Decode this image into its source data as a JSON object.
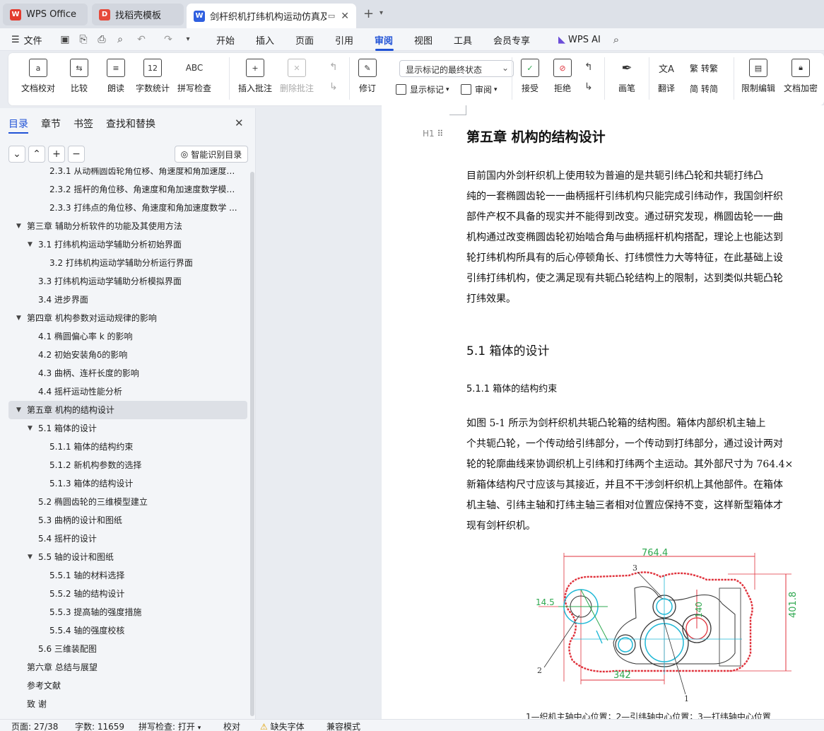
{
  "tabs": [
    {
      "label": "WPS Office",
      "icon": "wps-logo",
      "color": "#e33b2e"
    },
    {
      "label": "找稻壳模板",
      "icon": "docer-logo",
      "color": "#e64a3b"
    },
    {
      "label": "剑杆织机打纬机构运动仿真及",
      "icon": "word-doc-icon",
      "color": "#2f5fe0"
    }
  ],
  "menu": {
    "file": "文件",
    "items": [
      "开始",
      "插入",
      "页面",
      "引用",
      "审阅",
      "视图",
      "工具",
      "会员专享"
    ],
    "active": "审阅",
    "ai": "WPS AI"
  },
  "ribbon": {
    "doc_check": "文档校对",
    "compare": "比较",
    "read_aloud": "朗读",
    "word_count": "字数统计",
    "spell_check": "拼写检查",
    "insert_comment": "插入批注",
    "delete_comment": "删除批注",
    "revise": "修订",
    "markup_state": "显示标记的最终状态",
    "show_markup": "显示标记",
    "review": "审阅",
    "accept": "接受",
    "reject": "拒绝",
    "pen": "画笔",
    "translate": "翻译",
    "to_traditional": "转繁",
    "to_simplified": "转简",
    "restrict_edit": "限制编辑",
    "encrypt": "文档加密"
  },
  "nav": {
    "tabs": [
      "目录",
      "章节",
      "书签",
      "查找和替换"
    ],
    "smart_button": "智能识别目录",
    "toc": [
      {
        "text": "2.3.1 从动椭圆齿轮角位移、角速度和角加速度数学模型",
        "level": 3
      },
      {
        "text": "2.3.2 摇杆的角位移、角速度和角加速度数学模型 ...",
        "level": 3
      },
      {
        "text": "2.3.3  打纬点的角位移、角速度和角加速度数学 ...",
        "level": 3
      },
      {
        "text": "第三章  辅助分析软件的功能及其使用方法",
        "level": 1,
        "arrow": true
      },
      {
        "text": "3.1  打纬机构运动学辅助分析初始界面",
        "level": 2,
        "arrow": true
      },
      {
        "text": "3.2 打纬机构运动学辅助分析运行界面",
        "level": 3
      },
      {
        "text": "3.3  打纬机构运动学辅助分析模拟界面",
        "level": 2
      },
      {
        "text": "3.4 进步界面",
        "level": 2
      },
      {
        "text": "第四章  机构参数对运动规律的影响",
        "level": 1,
        "arrow": true
      },
      {
        "text": "4.1  椭圆偏心率 k 的影响",
        "level": 2
      },
      {
        "text": "4.2 初始安装角δ的影响",
        "level": 2
      },
      {
        "text": "4.3  曲柄、连杆长度的影响",
        "level": 2
      },
      {
        "text": "4.4  摇杆运动性能分析",
        "level": 2
      },
      {
        "text": "第五章  机构的结构设计",
        "level": 1,
        "arrow": true,
        "active": true
      },
      {
        "text": "5.1  箱体的设计",
        "level": 2,
        "arrow": true
      },
      {
        "text": "5.1.1  箱体的结构约束",
        "level": 3
      },
      {
        "text": "5.1.2  新机构参数的选择",
        "level": 3
      },
      {
        "text": "5.1.3  箱体的结构设计",
        "level": 3
      },
      {
        "text": "5.2  椭圆齿轮的三维模型建立",
        "level": 2
      },
      {
        "text": "5.3  曲柄的设计和图纸",
        "level": 2
      },
      {
        "text": "5.4  摇杆的设计",
        "level": 2
      },
      {
        "text": "5.5 轴的设计和图纸",
        "level": 2,
        "arrow": true
      },
      {
        "text": "5.5.1  轴的材料选择",
        "level": 3
      },
      {
        "text": "5.5.2  轴的结构设计",
        "level": 3
      },
      {
        "text": "5.5.3 提高轴的强度措施",
        "level": 3
      },
      {
        "text": "5.5.4  轴的强度校核",
        "level": 3
      },
      {
        "text": "5.6  三维装配图",
        "level": 2
      },
      {
        "text": "第六章  总结与展望",
        "level": 1
      },
      {
        "text": "参考文献",
        "level": 1
      },
      {
        "text": "致    谢",
        "level": 1
      }
    ]
  },
  "doc": {
    "h_marker": "H1",
    "chapter_title": "第五章  机构的结构设计",
    "para1": [
      "    目前国内外剑杆织机上使用较为普遍的是共轭引纬凸轮和共轭打纬凸",
      "纯的一套椭圆齿轮一一曲柄摇杆引纬机构只能完成引纬动作，我国剑杆织",
      "部件产权不具备的现实并不能得到改变。通过研究发现，椭圆齿轮一一曲",
      "机构通过改变椭圆齿轮初始啮合角与曲柄摇杆机构搭配，理论上也能达到",
      "轮打纬机构所具有的后心停顿角长、打纬惯性力大等特征，在此基础上设",
      "引纬打纬机构，使之满足现有共轭凸轮结构上的限制，达到类似共轭凸轮",
      "打纬效果。"
    ],
    "section_title": "5.1  箱体的设计",
    "subsection_title": "5.1.1  箱体的结构约束",
    "para2": [
      "    如图 5-1 所示为剑杆织机共轭凸轮箱的结构图。箱体内部织机主轴上",
      "个共轭凸轮，一个传动给引纬部分，一个传动到打纬部分，通过设计两对",
      "轮的轮廓曲线来协调织机上引纬和打纬两个主运动。其外部尺寸为 764.4×",
      "新箱体结构尺寸应该与其接近，并且不干涉剑杆织机上其他部件。在箱体",
      "机主轴、引纬主轴和打纬主轴三者相对位置应保持不变，这样新型箱体才",
      "现有剑杆织机。"
    ],
    "figure": {
      "dim_width": "764.4",
      "dim_height": "401.8",
      "dim_bottom": "342",
      "dim_left": "14.5",
      "dim_mid": "140",
      "label1": "1",
      "label2": "2",
      "label3": "3"
    },
    "caption": "1—织机主轴中心位置；2—引纬轴中心位置；3—打纬轴中心位置"
  },
  "status": {
    "page": "页面: 27/38",
    "words": "字数: 11659",
    "spell": "拼写检查: 打开",
    "proof": "校对",
    "missing_font": "缺失字体",
    "compat": "兼容模式"
  },
  "colors": {
    "accent": "#2052d6",
    "drawing_red": "#e0323c",
    "drawing_green": "#2ea84f",
    "drawing_cyan": "#1fb8d6"
  }
}
